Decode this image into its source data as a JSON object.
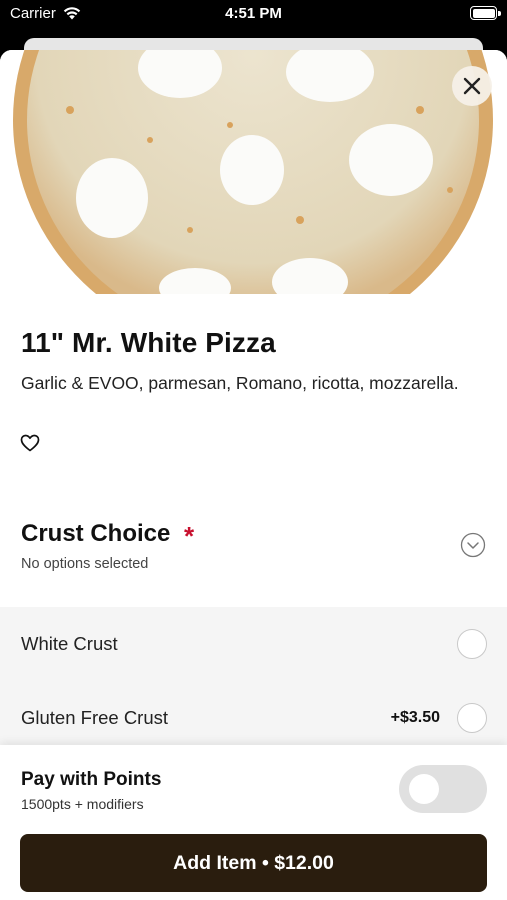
{
  "status_bar": {
    "carrier": "Carrier",
    "time": "4:51 PM"
  },
  "product": {
    "name": "11\" Mr. White Pizza",
    "description": "Garlic & EVOO, parmesan, Romano, ricotta, mozzarella.",
    "image_icon": "pizza-photo"
  },
  "icons": {
    "close": "close-icon",
    "favorite": "heart-icon",
    "expand": "chevron-down-icon"
  },
  "crust_section": {
    "title": "Crust Choice",
    "required_mark": "*",
    "subtitle": "No options selected",
    "options": [
      {
        "label": "White Crust",
        "price": "",
        "selected": false
      },
      {
        "label": "Gluten Free Crust",
        "price": "+$3.50",
        "selected": false
      }
    ]
  },
  "points": {
    "title": "Pay with Points",
    "subtitle": "1500pts + modifiers",
    "enabled": false
  },
  "add_button": {
    "label": "Add Item • $12.00"
  },
  "colors": {
    "required": "#c8102e",
    "button_bg": "#2a1d0e",
    "option_bg": "#f5f5f5"
  }
}
